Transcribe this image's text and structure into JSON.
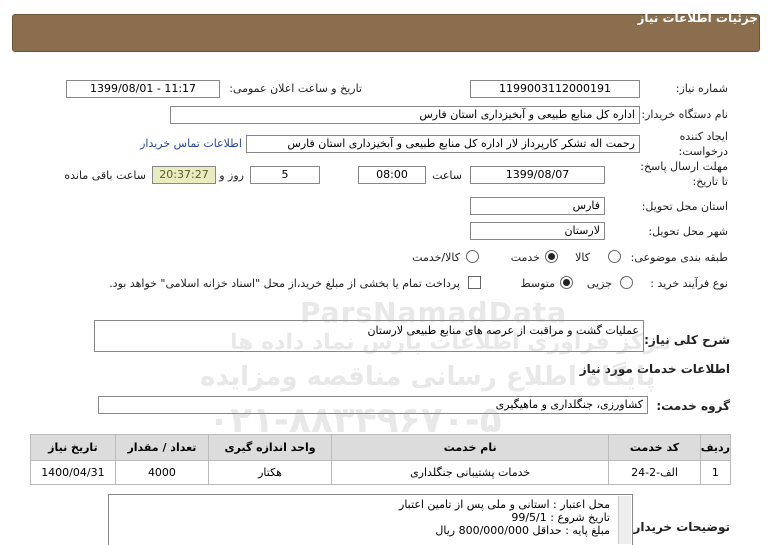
{
  "header": {
    "title": "جزئیات اطلاعات نیاز"
  },
  "need_number": {
    "label": "شماره نیاز:",
    "value": "1199003112000191"
  },
  "announce": {
    "label": "تاریخ و ساعت اعلان عمومی:",
    "value": "1399/08/01 - 11:17"
  },
  "buyer_org": {
    "label": "نام دستگاه خریدار:",
    "value": "اداره کل منابع طبیعی و آبخیزداری استان فارس"
  },
  "creator": {
    "label_1": "ایجاد کننده",
    "label_2": "درخواست:",
    "value": "رحمت اله تشکر کارپرداز لار اداره کل منابع طبیعی و آبخیزداری استان فارس",
    "contact_link": "اطلاعات تماس خریدار"
  },
  "deadline": {
    "label_1": "مهلت ارسال پاسخ:",
    "label_2": "تا تاریخ:",
    "date": "1399/08/07",
    "time_label": "ساعت",
    "time": "08:00",
    "days": "5",
    "days_label": "روز و",
    "remaining": "20:37:27",
    "remaining_label": "ساعت باقی مانده"
  },
  "province": {
    "label": "استان محل تحویل:",
    "value": "فارس"
  },
  "city": {
    "label": "شهر محل تحویل:",
    "value": "لارستان"
  },
  "category": {
    "label": "طبقه بندی موضوعی:",
    "options": [
      "کالا",
      "خدمت",
      "کالا/خدمت"
    ],
    "selected": "خدمت"
  },
  "process": {
    "label": "نوع فرآیند خرید :",
    "options": [
      "جزیی",
      "متوسط"
    ],
    "selected": "متوسط",
    "payment_note": "پرداخت تمام یا بخشی از مبلغ خرید،از محل \"اسناد خزانه اسلامی\" خواهد بود."
  },
  "summary": {
    "label": "شرح کلی نیاز:",
    "value": "عملیات گشت و مراقبت از عرصه های منابع طبیعی لارستان"
  },
  "services_title": "اطلاعات خدمات مورد نیاز",
  "service_group": {
    "label": "گروه خدمت:",
    "value": "کشاورزی، جنگلداری و ماهیگیری"
  },
  "table": {
    "headers": [
      "ردیف",
      "کد خدمت",
      "نام خدمت",
      "واحد اندازه گیری",
      "تعداد / مقدار",
      "تاریخ نیاز"
    ],
    "rows": [
      [
        "1",
        "الف-2-24",
        "خدمات پشتیبانی جنگلداری",
        "هکتار",
        "4000",
        "1400/04/31"
      ]
    ]
  },
  "buyer_notes": {
    "label": "توضیحات خریدار:",
    "lines": [
      "محل اعتبار : استانی و ملی پس از تامین اعتبار",
      "تاریخ شروع : 99/5/1",
      "مبلغ پایه : حداقل 800/000/000 ریال"
    ]
  },
  "watermark": {
    "line1": "ParsNamadData",
    "line2": "مرکز فراوری اطلاعات پارس نماد داده ها",
    "line3": "پایگاه اطلاع رسانی مناقصه ومزایده",
    "line4": "۰۲۱-۸۸۳۴۹۶۷۰-۵"
  }
}
